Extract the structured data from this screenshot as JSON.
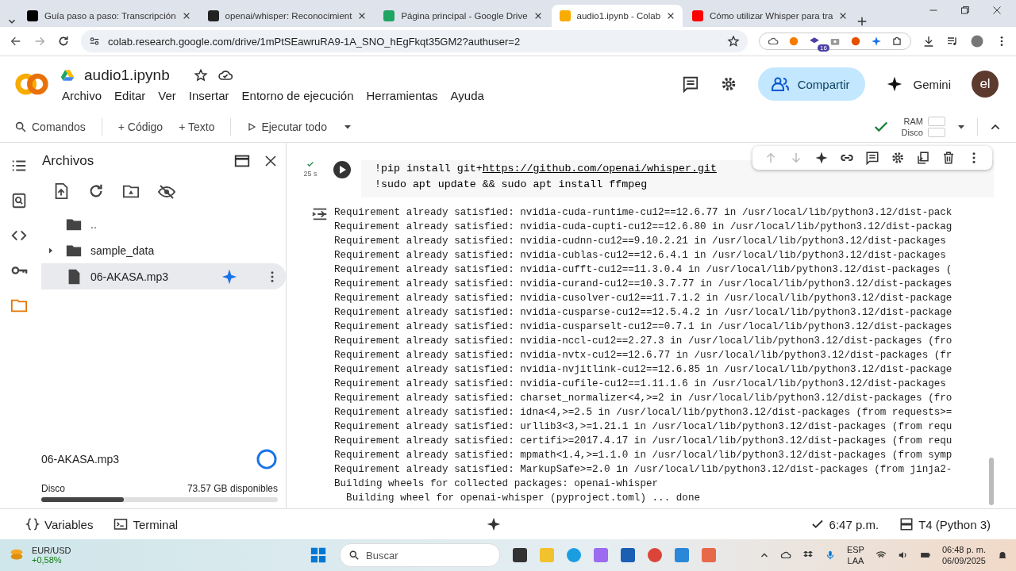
{
  "browser": {
    "tabs": [
      {
        "title": "Guía paso a paso: Transcripción",
        "kind": "medium",
        "selected": false
      },
      {
        "title": "openai/whisper: Reconocimient",
        "kind": "github",
        "selected": false
      },
      {
        "title": "Página principal - Google Drive",
        "kind": "drive",
        "selected": false
      },
      {
        "title": "audio1.ipynb - Colab",
        "kind": "colab",
        "selected": true
      },
      {
        "title": "Cómo utilizar Whisper para tra",
        "kind": "youtube",
        "selected": false
      }
    ],
    "address": "colab.research.google.com/drive/1mPtSEawruRA9-1A_SNO_hEgFkqt35GM2?authuser=2",
    "extension_badge": "16"
  },
  "header": {
    "notebook_title": "audio1.ipynb",
    "menu": [
      "Archivo",
      "Editar",
      "Ver",
      "Insertar",
      "Entorno de ejecución",
      "Herramientas",
      "Ayuda"
    ],
    "share_button": "Compartir",
    "gemini_button": "Gemini",
    "avatar": "el"
  },
  "toolbar": {
    "commands": "Comandos",
    "add_code": "+ Código",
    "add_text": "+ Texto",
    "run_all": "Ejecutar todo",
    "ram_label": "RAM",
    "disk_label": "Disco"
  },
  "rail": [
    {
      "kind": "toc",
      "selected": false
    },
    {
      "kind": "find",
      "selected": false
    },
    {
      "kind": "code",
      "selected": false
    },
    {
      "kind": "secrets",
      "selected": false
    },
    {
      "kind": "files",
      "selected": true
    }
  ],
  "files_panel": {
    "title": "Archivos",
    "items": [
      {
        "name": "..",
        "kind": "parent",
        "selected": false
      },
      {
        "name": "sample_data",
        "kind": "folder",
        "selected": false
      },
      {
        "name": "06-AKASA.mp3",
        "kind": "file",
        "selected": true
      }
    ],
    "upload_name": "06-AKASA.mp3",
    "disk_label": "Disco",
    "disk_free": "73.57 GB disponibles",
    "disk_usage": {
      "level": 0.35
    }
  },
  "cell": {
    "run_time": "25 s",
    "code": [
      {
        "text": "!pip install git+",
        "link": "https://github.com/openai/whisper.git"
      },
      {
        "text": "!sudo apt update && sudo apt install ffmpeg"
      }
    ],
    "output": [
      "Requirement already satisfied: nvidia-cuda-runtime-cu12==12.6.77 in /usr/local/lib/python3.12/dist-pack",
      "Requirement already satisfied: nvidia-cuda-cupti-cu12==12.6.80 in /usr/local/lib/python3.12/dist-packag",
      "Requirement already satisfied: nvidia-cudnn-cu12==9.10.2.21 in /usr/local/lib/python3.12/dist-packages",
      "Requirement already satisfied: nvidia-cublas-cu12==12.6.4.1 in /usr/local/lib/python3.12/dist-packages",
      "Requirement already satisfied: nvidia-cufft-cu12==11.3.0.4 in /usr/local/lib/python3.12/dist-packages (",
      "Requirement already satisfied: nvidia-curand-cu12==10.3.7.77 in /usr/local/lib/python3.12/dist-packages",
      "Requirement already satisfied: nvidia-cusolver-cu12==11.7.1.2 in /usr/local/lib/python3.12/dist-package",
      "Requirement already satisfied: nvidia-cusparse-cu12==12.5.4.2 in /usr/local/lib/python3.12/dist-package",
      "Requirement already satisfied: nvidia-cusparselt-cu12==0.7.1 in /usr/local/lib/python3.12/dist-packages",
      "Requirement already satisfied: nvidia-nccl-cu12==2.27.3 in /usr/local/lib/python3.12/dist-packages (fro",
      "Requirement already satisfied: nvidia-nvtx-cu12==12.6.77 in /usr/local/lib/python3.12/dist-packages (fr",
      "Requirement already satisfied: nvidia-nvjitlink-cu12==12.6.85 in /usr/local/lib/python3.12/dist-package",
      "Requirement already satisfied: nvidia-cufile-cu12==1.11.1.6 in /usr/local/lib/python3.12/dist-packages",
      "Requirement already satisfied: charset_normalizer<4,>=2 in /usr/local/lib/python3.12/dist-packages (fro",
      "Requirement already satisfied: idna<4,>=2.5 in /usr/local/lib/python3.12/dist-packages (from requests>=",
      "Requirement already satisfied: urllib3<3,>=1.21.1 in /usr/local/lib/python3.12/dist-packages (from requ",
      "Requirement already satisfied: certifi>=2017.4.17 in /usr/local/lib/python3.12/dist-packages (from requ",
      "Requirement already satisfied: mpmath<1.4,>=1.1.0 in /usr/local/lib/python3.12/dist-packages (from symp",
      "Requirement already satisfied: MarkupSafe>=2.0 in /usr/local/lib/python3.12/dist-packages (from jinja2-",
      "Building wheels for collected packages: openai-whisper",
      "  Building wheel for openai-whisper (pyproject.toml) ... done"
    ]
  },
  "status_bar": {
    "variables": "Variables",
    "terminal": "Terminal",
    "time": "6:47 p.m.",
    "runtime": "T4 (Python 3)"
  },
  "taskbar": {
    "widget_title": "EUR/USD",
    "widget_value": "+0,58%",
    "search_placeholder": "Buscar",
    "language": "ESP",
    "layout": "LAA",
    "time": "06:48 p. m.",
    "date": "06/09/2025"
  }
}
